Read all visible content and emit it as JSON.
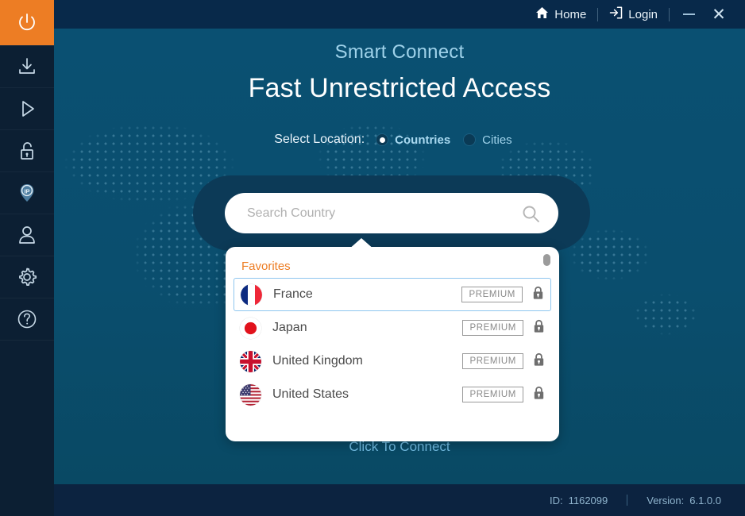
{
  "sidebar": {
    "items": [
      {
        "icon": "power-icon",
        "name": "power",
        "active": true
      },
      {
        "icon": "download-icon",
        "name": "download",
        "active": false
      },
      {
        "icon": "play-icon",
        "name": "play",
        "active": false
      },
      {
        "icon": "unlock-icon",
        "name": "unlock",
        "active": false
      },
      {
        "icon": "ip-location-pin-icon",
        "name": "ip",
        "active": false
      },
      {
        "icon": "user-icon",
        "name": "account",
        "active": false
      },
      {
        "icon": "gear-icon",
        "name": "settings",
        "active": false
      },
      {
        "icon": "help-question-icon",
        "name": "help",
        "active": false
      }
    ]
  },
  "titlebar": {
    "home_label": "Home",
    "login_label": "Login",
    "minimize_label": "Minimize",
    "close_label": "Close"
  },
  "main": {
    "smart_connect": "Smart Connect",
    "headline": "Fast Unrestricted Access",
    "select_location_label": "Select Location:",
    "options": [
      {
        "label": "Countries",
        "selected": true
      },
      {
        "label": "Cities",
        "selected": false
      }
    ],
    "click_to_connect": "Click To Connect"
  },
  "search": {
    "placeholder": "Search Country",
    "value": "",
    "icon": "search-icon"
  },
  "dropdown": {
    "section_label": "Favorites",
    "badge_label": "PREMIUM",
    "rows": [
      {
        "country": "France",
        "flag": "fr",
        "badge": "PREMIUM",
        "locked": true,
        "selected": true
      },
      {
        "country": "Japan",
        "flag": "jp",
        "badge": "PREMIUM",
        "locked": true,
        "selected": false
      },
      {
        "country": "United Kingdom",
        "flag": "gb",
        "badge": "PREMIUM",
        "locked": true,
        "selected": false
      },
      {
        "country": "United States",
        "flag": "us",
        "badge": "PREMIUM",
        "locked": true,
        "selected": false
      }
    ]
  },
  "footer": {
    "id_label": "ID:",
    "id_value": "1162099",
    "version_label": "Version:",
    "version_value": "6.1.0.0"
  },
  "colors": {
    "accent_orange": "#ed7d24",
    "titlebar_navy": "#08294a",
    "body_teal": "#0a5072",
    "sidebar_navy": "#0c1f33",
    "highlight_blue": "#8ec6ef",
    "heading_light_blue": "#9fd2ea"
  }
}
